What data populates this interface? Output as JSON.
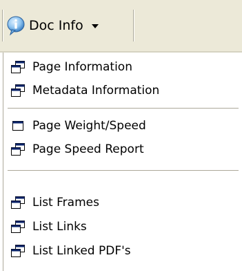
{
  "toolbar": {
    "docinfo_label": "Doc Info",
    "info_icon": "info-icon",
    "dropdown_icon": "chevron-down-icon"
  },
  "menu": {
    "groups": [
      {
        "items": [
          {
            "label": "Page Information",
            "icon": "cascade-windows-icon"
          },
          {
            "label": "Metadata Information",
            "icon": "cascade-windows-icon"
          }
        ]
      },
      {
        "items": [
          {
            "label": "Page Weight/Speed",
            "icon": "window-icon"
          },
          {
            "label": "Page Speed Report",
            "icon": "cascade-windows-icon"
          }
        ]
      },
      {
        "items": [
          {
            "label": "List Frames",
            "icon": "cascade-windows-icon"
          },
          {
            "label": "List Links",
            "icon": "cascade-windows-icon"
          },
          {
            "label": "List Linked PDF's",
            "icon": "cascade-windows-icon"
          }
        ]
      }
    ]
  },
  "colors": {
    "toolbar_bg": "#ece9d8",
    "menu_bg": "#ffffff",
    "icon_titlebar": "#0a246a",
    "icon_outline": "#000000",
    "separator": "#aca899"
  }
}
